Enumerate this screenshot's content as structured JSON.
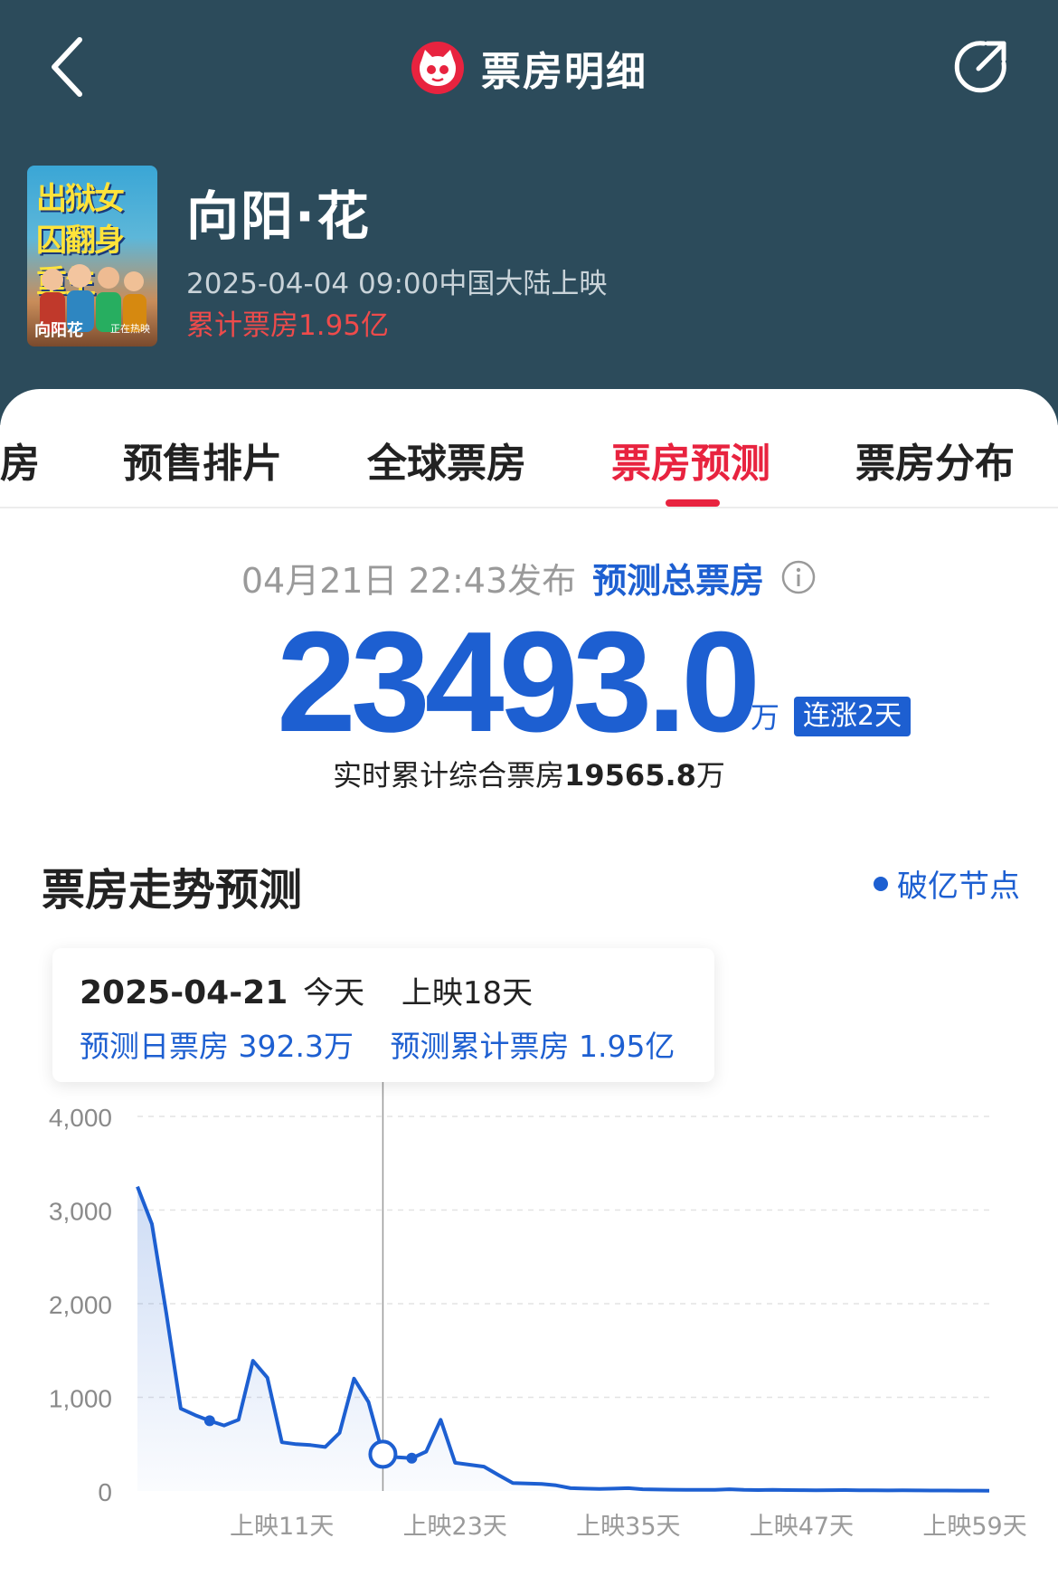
{
  "nav": {
    "title": "票房明细"
  },
  "movie": {
    "title": "向阳·花",
    "release": "2025-04-04 09:00中国大陆上映",
    "total_box_office": "累计票房1.95亿",
    "poster_text": "出狱女囚翻身重生",
    "poster_title": "向阳花",
    "poster_status": "正在热映"
  },
  "tabs": [
    {
      "label": "房",
      "active": false
    },
    {
      "label": "预售排片",
      "active": false
    },
    {
      "label": "全球票房",
      "active": false
    },
    {
      "label": "票房预测",
      "active": true
    },
    {
      "label": "票房分布",
      "active": false
    }
  ],
  "forecast": {
    "published": "04月21日 22:43发布",
    "label": "预测总票房",
    "value": "23493.0",
    "unit": "万",
    "badge": "连涨2天",
    "realtime_prefix": "实时累计综合票房",
    "realtime_value": "19565.8",
    "realtime_unit": "万"
  },
  "trend": {
    "title": "票房走势预测",
    "legend": "破亿节点",
    "tooltip": {
      "date": "2025-04-21",
      "today": "今天",
      "day": "上映18天",
      "daily": "预测日票房 392.3万",
      "cumulative": "预测累计票房 1.95亿"
    }
  },
  "colors": {
    "header_bg": "#2c4b5b",
    "accent_red": "#e8233f",
    "accent_blue": "#1d5fd1"
  },
  "chart_data": {
    "type": "area",
    "x_tick_labels": [
      "上映11天",
      "上映23天",
      "上映35天",
      "上映47天",
      "上映59天"
    ],
    "y_tick_labels": [
      "4,000",
      "3,000",
      "2,000",
      "1,000",
      "0"
    ],
    "ylim": [
      0,
      4000
    ],
    "xlim": [
      1,
      60
    ],
    "x": [
      1,
      2,
      3,
      4,
      5,
      6,
      7,
      8,
      9,
      10,
      11,
      12,
      13,
      14,
      15,
      16,
      17,
      18,
      19,
      20,
      21,
      22,
      23,
      24,
      25,
      26,
      27,
      28,
      29,
      30,
      31,
      32,
      33,
      34,
      35,
      36,
      37,
      38,
      39,
      40,
      41,
      42,
      43,
      44,
      45,
      46,
      47,
      48,
      49,
      50,
      51,
      52,
      53,
      54,
      55,
      56,
      57,
      58,
      59,
      60
    ],
    "values": [
      3250,
      2850,
      1900,
      880,
      810,
      750,
      700,
      760,
      1390,
      1210,
      520,
      500,
      490,
      470,
      620,
      1200,
      950,
      392,
      360,
      350,
      420,
      760,
      300,
      280,
      260,
      170,
      85,
      80,
      75,
      60,
      30,
      25,
      22,
      25,
      30,
      18,
      15,
      14,
      12,
      13,
      12,
      18,
      12,
      10,
      12,
      10,
      9,
      8,
      9,
      10,
      8,
      7,
      6,
      7,
      6,
      5,
      5,
      4,
      4,
      3
    ],
    "highlight_points": [
      6,
      18,
      20
    ],
    "selected_x": 18,
    "grid": true
  }
}
